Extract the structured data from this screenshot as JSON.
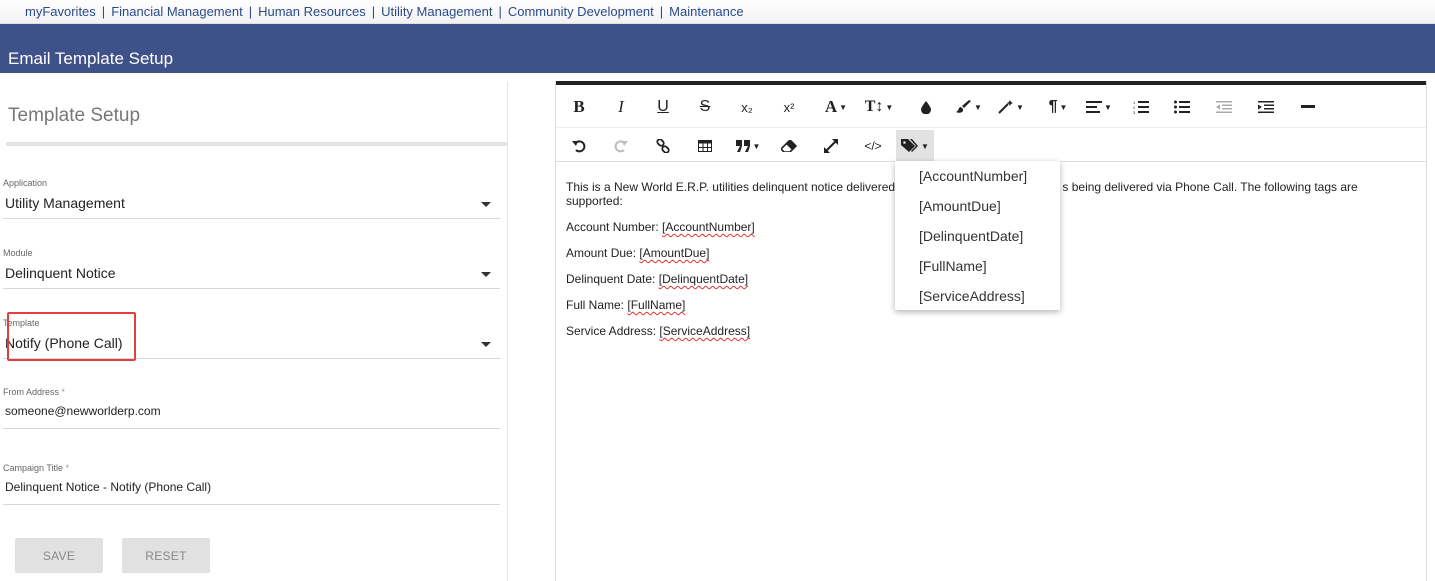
{
  "nav": {
    "items": [
      "myFavorites",
      "Financial Management",
      "Human Resources",
      "Utility Management",
      "Community Development",
      "Maintenance"
    ],
    "separator": "|"
  },
  "page": {
    "title": "Email Template Setup"
  },
  "left": {
    "header": "Template Setup",
    "application": {
      "label": "Application",
      "value": "Utility Management"
    },
    "module": {
      "label": "Module",
      "value": "Delinquent Notice"
    },
    "template": {
      "label": "Template",
      "value": "Notify (Phone Call)"
    },
    "from_address": {
      "label": "From Address",
      "required": "*",
      "value": "someone@newworlderp.com"
    },
    "campaign_title": {
      "label": "Campaign Title",
      "required": "*",
      "value": "Delinquent Notice - Notify (Phone Call)"
    },
    "save_label": "SAVE",
    "reset_label": "RESET"
  },
  "toolbar": {
    "bold": "B",
    "italic": "I",
    "underline": "U",
    "strike": "S",
    "subscript": "x₂",
    "superscript": "x²",
    "font": "A",
    "font_size": "T↕",
    "paragraph": "¶",
    "code_view": "</>"
  },
  "editor": {
    "intro_start": "This is a New World E.R.P. utilities delinquent notice delivered v",
    "intro_end": "s being delivered via Phone Call.  The following tags are supported:",
    "lines": [
      {
        "label": "Account Number: ",
        "tag": "[AccountNumber]"
      },
      {
        "label": "Amount Due: ",
        "tag": "[AmountDue]"
      },
      {
        "label": "Delinquent Date: ",
        "tag": "[DelinquentDate]"
      },
      {
        "label": "Full Name: ",
        "tag": "[FullName]"
      },
      {
        "label": "Service Address: ",
        "tag": "[ServiceAddress]"
      }
    ]
  },
  "tags_dropdown": [
    "[AccountNumber]",
    "[AmountDue]",
    "[DelinquentDate]",
    "[FullName]",
    "[ServiceAddress]"
  ]
}
